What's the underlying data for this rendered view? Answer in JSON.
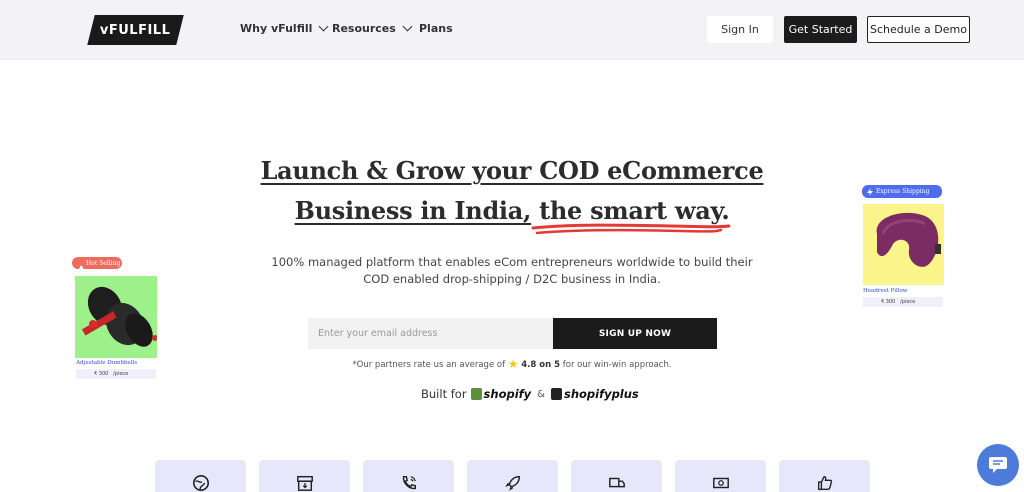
{
  "header": {
    "logo_text": "vFULFILL",
    "nav": [
      {
        "label": "Why vFulfill",
        "has_dropdown": true
      },
      {
        "label": "Resources",
        "has_dropdown": true
      },
      {
        "label": "Plans",
        "has_dropdown": false
      }
    ],
    "sign_in": "Sign In",
    "get_started": "Get Started",
    "schedule_demo": "Schedule a Demo"
  },
  "hero": {
    "title_line1": "Launch & Grow your COD eCommerce",
    "title_line2_a": "Business in India,",
    "title_line2_b": "the smart way.",
    "subtitle": "100% managed platform that enables eCom entrepreneurs worldwide to build their COD enabled drop-shipping / D2C business in India.",
    "email_placeholder": "Enter your email address",
    "signup_button": "SIGN UP NOW",
    "rating_prefix": "*Our partners rate us an average of",
    "rating_value": "4.8 on 5",
    "rating_suffix": "for our win-win approach.",
    "built_for": "Built for",
    "shopify": "shopify",
    "and": "&",
    "shopify_plus": "shopifyplus"
  },
  "cards": {
    "left": {
      "badge": "Hot Selling",
      "name": "Adjustable Dumbbells",
      "price": "₹ 300",
      "unit": "/piece"
    },
    "right": {
      "badge": "Express Shipping",
      "name": "Headrest Pillow",
      "price": "₹ 300",
      "unit": "/piece"
    }
  },
  "colors": {
    "accent_red": "#e53935",
    "badge_blue": "#4f6bf0",
    "chat_blue": "#4c7bd9"
  }
}
